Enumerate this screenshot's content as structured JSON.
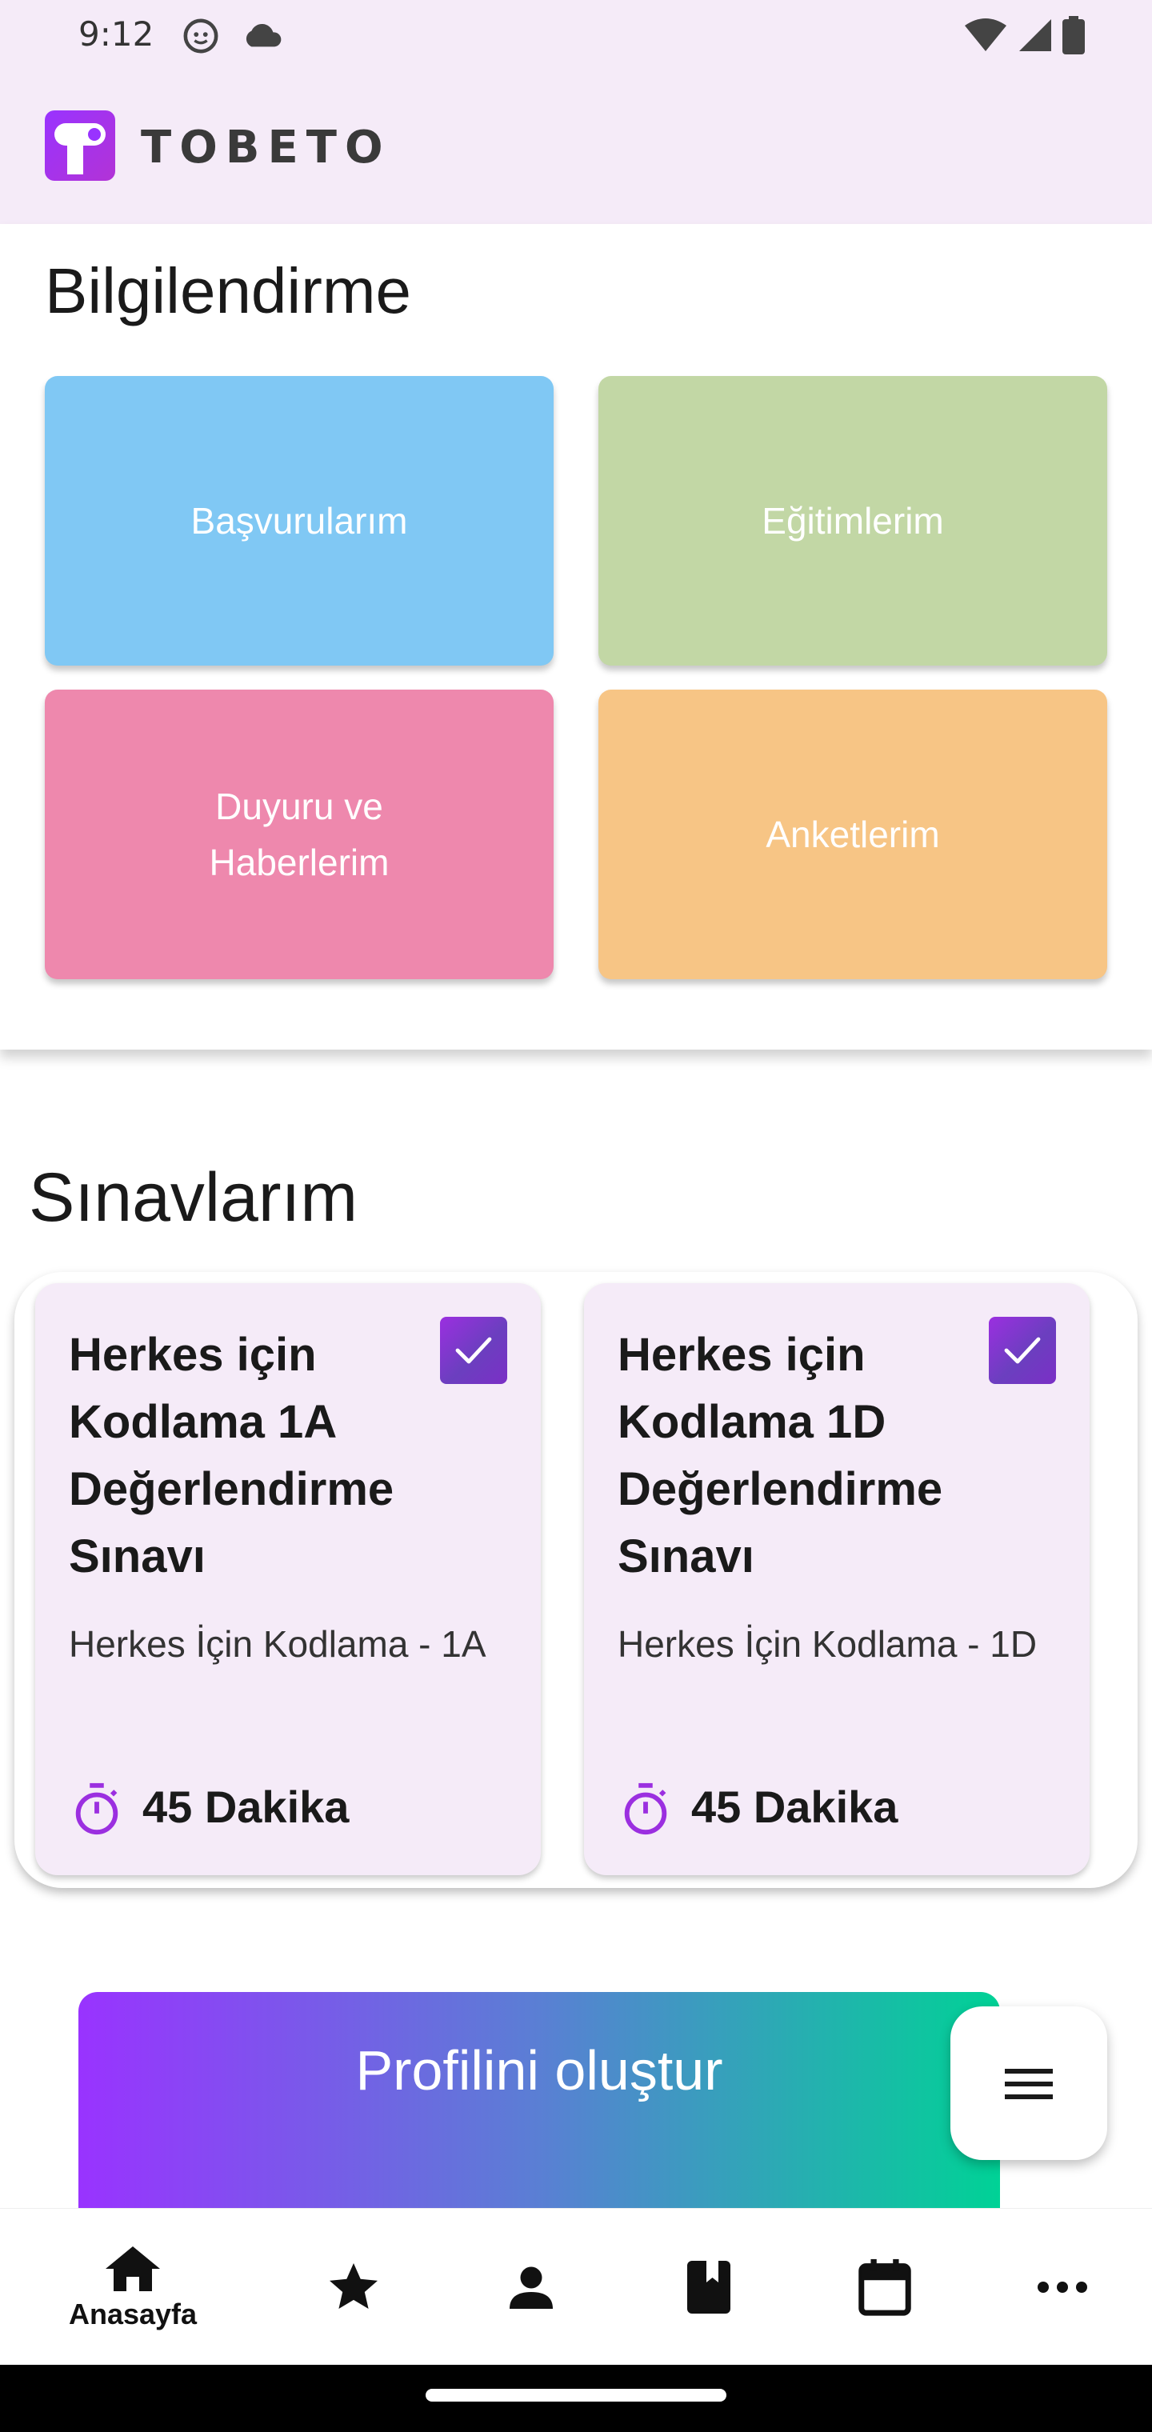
{
  "status_bar": {
    "time": "9:12"
  },
  "app_bar": {
    "logo_text": "TOBETO"
  },
  "info_section": {
    "title": "Bilgilendirme",
    "tiles": [
      {
        "label": "Başvurularım",
        "color": "#80c8f4"
      },
      {
        "label": "Eğitimlerim",
        "color": "#c2d7a5"
      },
      {
        "label": "Duyuru ve Haberlerim",
        "color": "#ee88ad"
      },
      {
        "label": "Anketlerim",
        "color": "#f7c585"
      }
    ]
  },
  "exams": {
    "title": "Sınavlarım",
    "cards": [
      {
        "title": "Herkes için Kodlama 1A Değerlendirme Sınavı",
        "subtitle": "Herkes İçin Kodlama - 1A",
        "duration": "45 Dakika"
      },
      {
        "title": "Herkes için Kodlama 1D Değerlendirme Sınavı",
        "subtitle": "Herkes İçin Kodlama - 1D",
        "duration": "45 Dakika"
      }
    ]
  },
  "profile_banner": {
    "label": "Profilini oluştur"
  },
  "fab": {
    "icon": "menu-icon"
  },
  "bottom_nav": {
    "items": [
      {
        "icon": "home-icon",
        "label": "Anasayfa",
        "active": true
      },
      {
        "icon": "star-icon"
      },
      {
        "icon": "person-icon"
      },
      {
        "icon": "book-icon"
      },
      {
        "icon": "calendar-icon"
      },
      {
        "icon": "more-icon"
      }
    ]
  },
  "colors": {
    "accent_purple": "#9b2fe0",
    "header_bg": "#f5ebf8"
  }
}
